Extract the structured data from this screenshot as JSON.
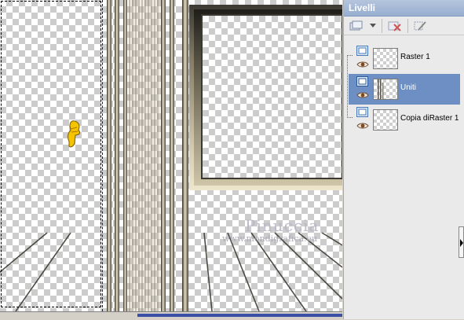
{
  "panel": {
    "title": "Livelli",
    "toolbar_icons": [
      "new-layer-icon",
      "dropdown-arrow-icon",
      "delete-layer-icon",
      "edit-mask-icon"
    ],
    "layers": [
      {
        "name": "Raster 1",
        "selected": false
      },
      {
        "name": "Uniti",
        "selected": true
      },
      {
        "name": "Copia diRaster 1",
        "selected": false
      }
    ]
  },
  "canvas": {
    "watermark_name": "Pinuccia",
    "watermark_url": "www.mondigrafica.eu"
  },
  "colors": {
    "panel_title_bg": "#98aed0",
    "selected_layer_bg": "#6e8fc4",
    "status_blue": "#3c4fa8"
  }
}
